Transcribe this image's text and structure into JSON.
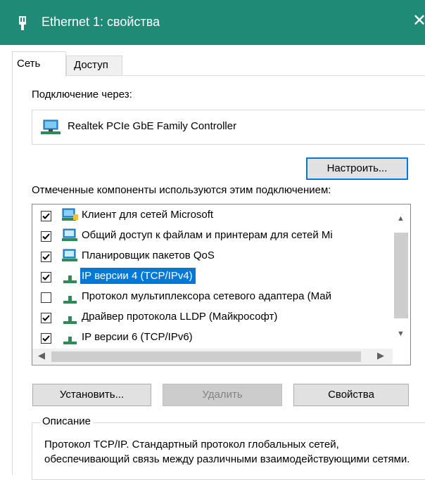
{
  "window": {
    "title": "Ethernet 1: свойства",
    "close_symbol": "✕",
    "accent_color": "#1f8a76"
  },
  "tabs": [
    {
      "label": "Сеть",
      "selected": true
    },
    {
      "label": "Доступ",
      "selected": false
    }
  ],
  "connection": {
    "label": "Подключение через:",
    "adapter": "Realtek PCIe GbE Family Controller",
    "configure_button": "Настроить..."
  },
  "components": {
    "label": "Отмеченные компоненты используются этим подключением:",
    "items": [
      {
        "label": "Клиент для сетей Microsoft",
        "checked": true,
        "icon": "network-client-icon"
      },
      {
        "label": "Общий доступ к файлам и принтерам для сетей Mi",
        "checked": true,
        "icon": "network-service-icon"
      },
      {
        "label": "Планировщик пакетов QoS",
        "checked": true,
        "icon": "network-service-icon"
      },
      {
        "label": "IP версии 4 (TCP/IPv4)",
        "checked": true,
        "icon": "protocol-icon",
        "selected": true
      },
      {
        "label": "Протокол мультиплексора сетевого адаптера (Май",
        "checked": false,
        "icon": "protocol-icon"
      },
      {
        "label": "Драйвер протокола LLDP (Майкрософт)",
        "checked": true,
        "icon": "protocol-icon"
      },
      {
        "label": "IP версии 6 (TCP/IPv6)",
        "checked": true,
        "icon": "protocol-icon"
      }
    ]
  },
  "buttons": {
    "install": "Установить...",
    "remove": "Удалить",
    "properties": "Свойства"
  },
  "description": {
    "legend": "Описание",
    "text": "Протокол TCP/IP. Стандартный протокол глобальных сетей, обеспечивающий связь между различными взаимодействующими сетями."
  }
}
